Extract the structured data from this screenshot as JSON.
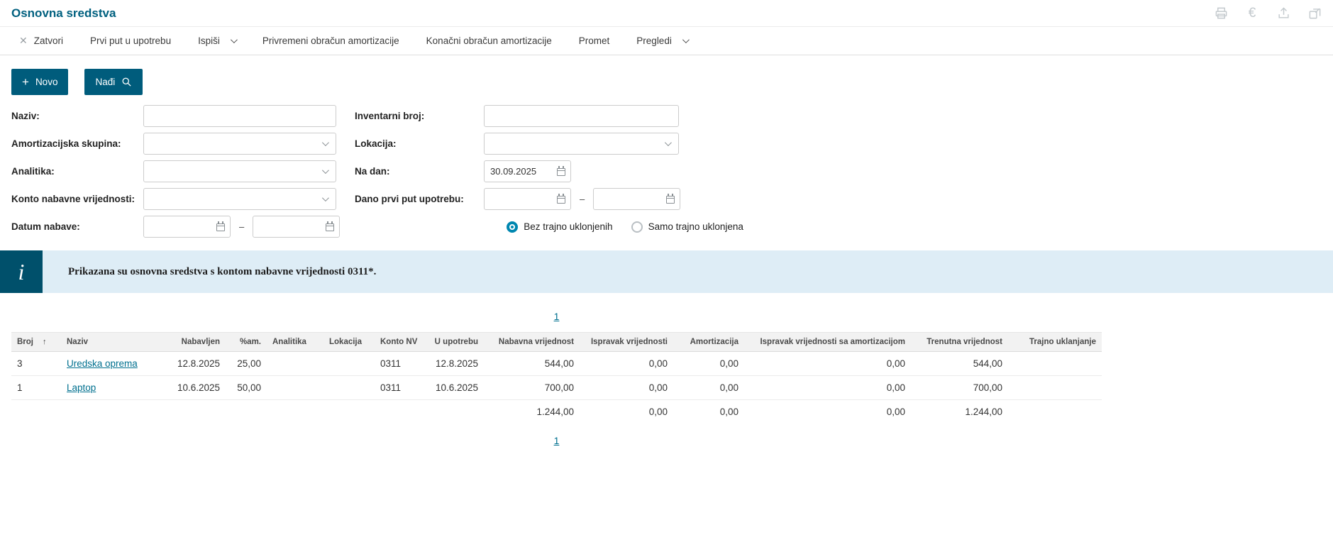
{
  "colors": {
    "accent": "#00607F",
    "button": "#005C7C",
    "banner_bg": "#DEEDF6",
    "banner_icon_bg": "#00506B",
    "link": "#00708F",
    "radio_checked": "#0087B0"
  },
  "header": {
    "title": "Osnovna sredstva",
    "icons": [
      "print-icon",
      "euro-icon",
      "upload-icon",
      "open-window-icon"
    ]
  },
  "toolbar": {
    "zatvori": "Zatvori",
    "prvi_put": "Prvi put u upotrebu",
    "ispisi": "Ispiši",
    "privremeni": "Privremeni obračun amortizacije",
    "konacni": "Konačni obračun amortizacije",
    "promet": "Promet",
    "pregledi": "Pregledi"
  },
  "actions": {
    "novo": "Novo",
    "nadi": "Nađi"
  },
  "filters": {
    "naziv_label": "Naziv:",
    "inventarni_broj_label": "Inventarni broj:",
    "amortizacijska_skupina_label": "Amortizacijska skupina:",
    "lokacija_label": "Lokacija:",
    "analitika_label": "Analitika:",
    "na_dan_label": "Na dan:",
    "na_dan_value": "30.09.2025",
    "konto_label": "Konto nabavne vrijednosti:",
    "dano_label": "Dano prvi put upotrebu:",
    "datum_nabave_label": "Datum nabave:",
    "range_dash": "–",
    "radio_bez": "Bez trajno uklonjenih",
    "radio_samo": "Samo trajno uklonjena"
  },
  "info": {
    "text": "Prikazana su osnovna sredstva s kontom nabavne vrijednosti 0311*."
  },
  "pagination": {
    "page": "1"
  },
  "table": {
    "headers": [
      "Broj",
      "Naziv",
      "Nabavljen",
      "%am.",
      "Analitika",
      "Lokacija",
      "Konto NV",
      "U upotrebu",
      "Nabavna vrijednost",
      "Ispravak vrijednosti",
      "Amortizacija",
      "Ispravak vrijednosti sa amortizacijom",
      "Trenutna vrijednost",
      "Trajno uklanjanje"
    ],
    "rows": [
      {
        "broj": "3",
        "naziv": "Uredska oprema",
        "nabavljen": "12.8.2025",
        "am": "25,00",
        "analitika": "",
        "lokacija": "",
        "konto": "0311",
        "upotreba": "12.8.2025",
        "nabavna": "544,00",
        "ispravak": "0,00",
        "amortizacija": "0,00",
        "ispravak_am": "0,00",
        "trenutna": "544,00",
        "trajno": ""
      },
      {
        "broj": "1",
        "naziv": "Laptop",
        "nabavljen": "10.6.2025",
        "am": "50,00",
        "analitika": "",
        "lokacija": "",
        "konto": "0311",
        "upotreba": "10.6.2025",
        "nabavna": "700,00",
        "ispravak": "0,00",
        "amortizacija": "0,00",
        "ispravak_am": "0,00",
        "trenutna": "700,00",
        "trajno": ""
      }
    ],
    "totals": {
      "nabavna": "1.244,00",
      "ispravak": "0,00",
      "amortizacija": "0,00",
      "ispravak_am": "0,00",
      "trenutna": "1.244,00"
    }
  }
}
